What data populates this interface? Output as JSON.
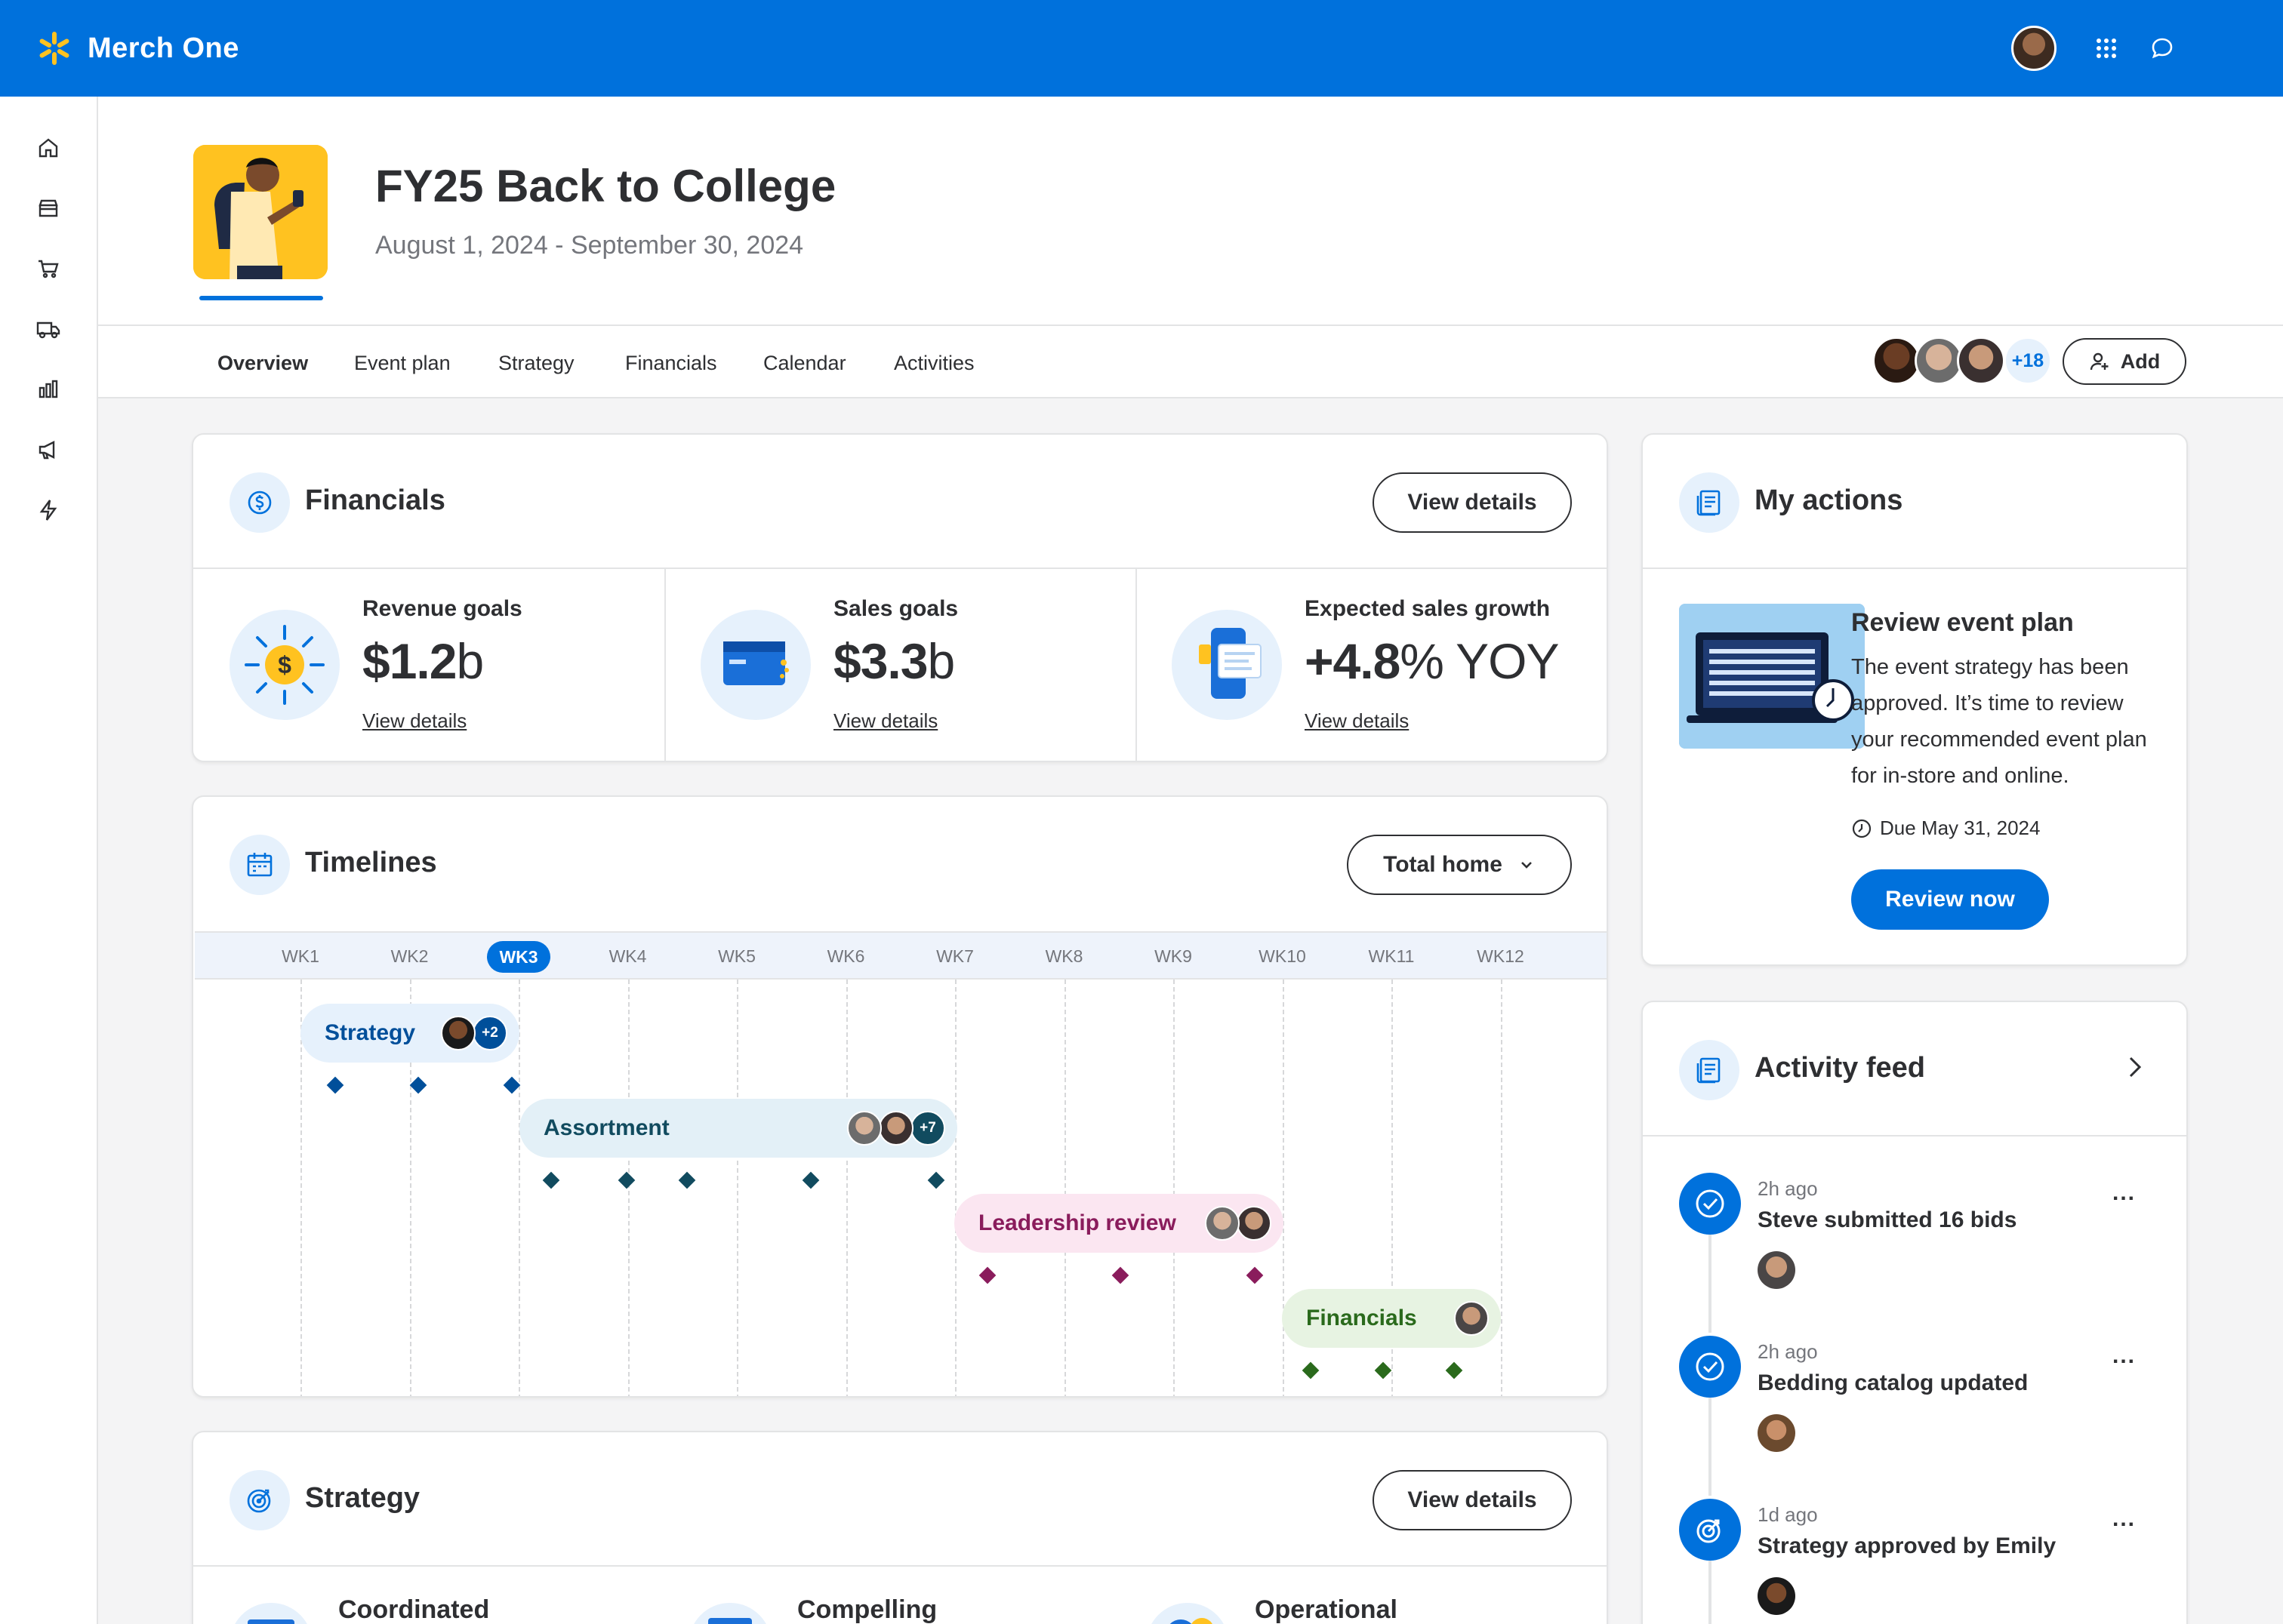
{
  "app": {
    "name": "Merch One"
  },
  "colors": {
    "primary": "#0071dc",
    "spark": "#ffc220",
    "text": "#2e2f32",
    "muted": "#74767c"
  },
  "topbar": {
    "icons": [
      "avatar",
      "apps-grid-icon",
      "chat-icon"
    ]
  },
  "sidenav": {
    "items": [
      "home-icon",
      "store-icon",
      "cart-icon",
      "truck-icon",
      "bar-chart-icon",
      "megaphone-icon",
      "bolt-icon"
    ]
  },
  "event": {
    "title": "FY25 Back to College",
    "dates": "August 1, 2024 - September 30, 2024"
  },
  "tabs": [
    {
      "label": "Overview",
      "active": true
    },
    {
      "label": "Event plan"
    },
    {
      "label": "Strategy"
    },
    {
      "label": "Financials"
    },
    {
      "label": "Calendar"
    },
    {
      "label": "Activities"
    }
  ],
  "collaborators": {
    "more": "+18",
    "add_label": "Add"
  },
  "financials": {
    "title": "Financials",
    "view_details": "View details",
    "kpis": [
      {
        "label": "Revenue goals",
        "value": "$1.2",
        "unit": "b",
        "link": "View details"
      },
      {
        "label": "Sales goals",
        "value": "$3.3",
        "unit": "b",
        "link": "View details"
      },
      {
        "label": "Expected sales growth",
        "value": "+4.8",
        "unit": "% YOY",
        "link": "View details"
      }
    ]
  },
  "timelines": {
    "title": "Timelines",
    "filter": "Total home",
    "weeks": [
      "WK1",
      "WK2",
      "WK3",
      "WK4",
      "WK5",
      "WK6",
      "WK7",
      "WK8",
      "WK9",
      "WK10",
      "WK11",
      "WK12"
    ],
    "current_week": "WK3",
    "phases": [
      {
        "label": "Strategy",
        "more": "+2",
        "color": "#004f9a"
      },
      {
        "label": "Assortment",
        "more": "+7",
        "color": "#114b5f"
      },
      {
        "label": "Leadership review",
        "color": "#8a1c5c"
      },
      {
        "label": "Financials",
        "color": "#2a6a1c"
      }
    ]
  },
  "strategy": {
    "title": "Strategy",
    "view_details": "View details",
    "items": [
      "Coordinated",
      "Compelling",
      "Operational"
    ]
  },
  "my_actions": {
    "title": "My actions",
    "task_title": "Review event plan",
    "task_desc": "The event strategy has been approved. It’s time to review your recommended event plan for in-store and online.",
    "due": "Due May 31, 2024",
    "cta": "Review now"
  },
  "activity_feed": {
    "title": "Activity feed",
    "items": [
      {
        "time": "2h ago",
        "text": "Steve submitted 16 bids",
        "icon": "check-circle-icon"
      },
      {
        "time": "2h ago",
        "text": "Bedding catalog updated",
        "icon": "check-circle-icon"
      },
      {
        "time": "1d ago",
        "text": "Strategy approved by Emily",
        "icon": "target-icon"
      }
    ],
    "more": "..."
  }
}
